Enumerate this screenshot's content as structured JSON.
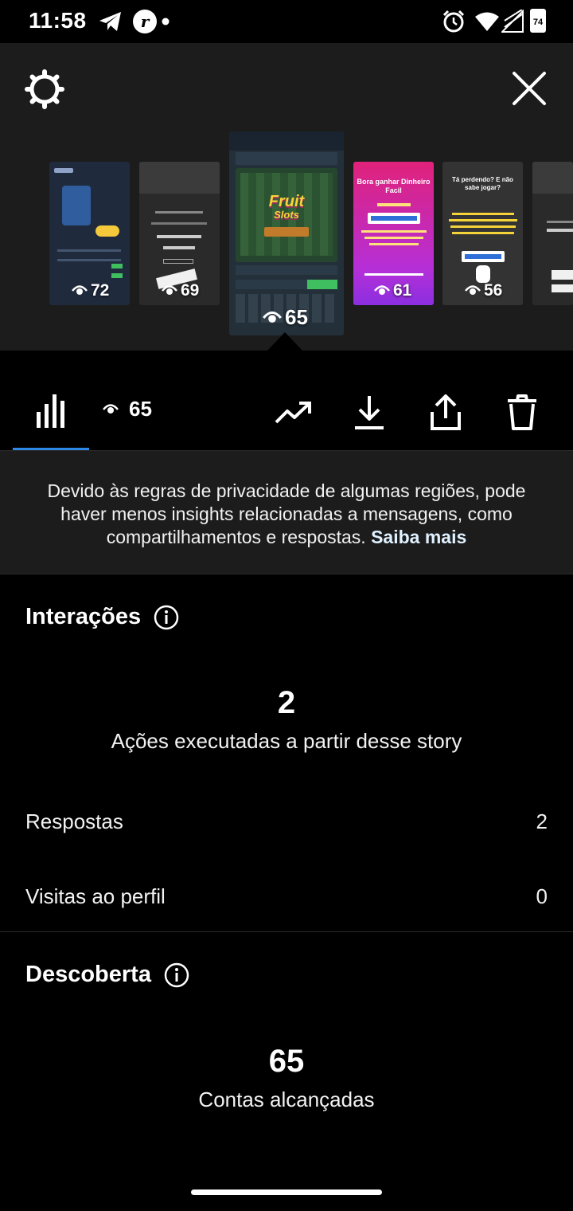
{
  "status_bar": {
    "time": "11:58",
    "battery": "74",
    "icons": [
      "telegram-icon",
      "app-r-icon",
      "dot-icon",
      "alarm-icon",
      "wifi-icon",
      "signal-icon",
      "battery-icon"
    ]
  },
  "header": {
    "settings_icon": "gear-icon",
    "close_icon": "close-icon"
  },
  "thumbnails": [
    {
      "views": "72",
      "selected": false
    },
    {
      "views": "69",
      "selected": false
    },
    {
      "views": "65",
      "selected": true,
      "title_line1": "Fruit",
      "title_line2": "Slots"
    },
    {
      "views": "61",
      "selected": false,
      "text": "Bora ganhar Dinheiro Facil"
    },
    {
      "views": "56",
      "selected": false,
      "text": "Tá perdendo? E não sabe jogar?"
    },
    {
      "views": "",
      "selected": false
    }
  ],
  "toolbar": {
    "views": "65",
    "icons": [
      "bar-chart-icon",
      "eye-icon",
      "trending-icon",
      "download-icon",
      "share-icon",
      "trash-icon"
    ]
  },
  "notice": {
    "text": "Devido às regras de privacidade de algumas regiões, pode haver menos insights relacionadas a mensagens, como compartilhamentos e respostas.",
    "link": "Saiba mais"
  },
  "interactions": {
    "title": "Interações",
    "total": "2",
    "total_label": "Ações executadas a partir desse story",
    "rows": [
      {
        "label": "Respostas",
        "value": "2"
      },
      {
        "label": "Visitas ao perfil",
        "value": "0"
      }
    ]
  },
  "discovery": {
    "title": "Descoberta",
    "total": "65",
    "total_label": "Contas alcançadas"
  },
  "colors": {
    "accent": "#2d88e8",
    "panel": "#1c1c1c",
    "background": "#000000"
  }
}
